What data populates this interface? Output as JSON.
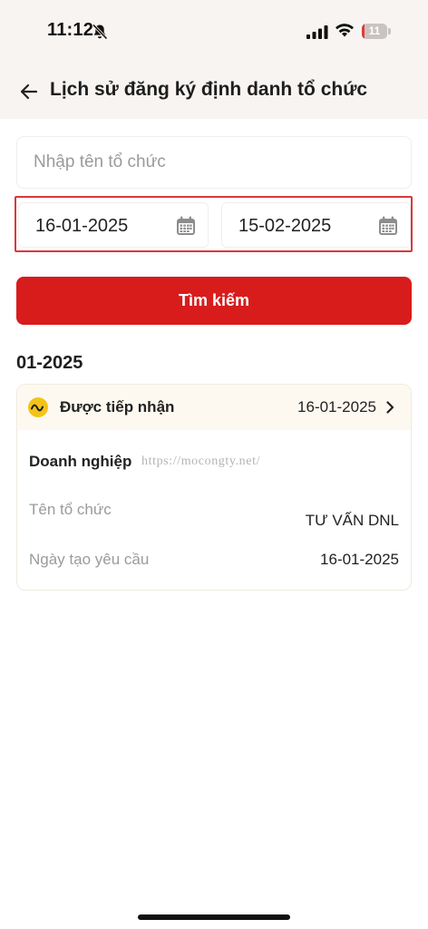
{
  "status_bar": {
    "time": "11:12",
    "battery_level": "11",
    "battery_percent": 0.11,
    "icons": [
      "bell-muted-icon",
      "cellular-signal-icon",
      "wifi-icon",
      "battery-icon"
    ]
  },
  "header": {
    "title": "Lịch sử đăng ký định danh tổ chức",
    "back_icon": "arrow-left-icon"
  },
  "search": {
    "name_placeholder": "Nhập tên tổ chức",
    "name_value": "",
    "from_date": "16-01-2025",
    "to_date": "15-02-2025",
    "calendar_icon": "calendar-icon",
    "button_label": "Tìm kiếm"
  },
  "results": {
    "section_title": "01-2025",
    "items": [
      {
        "status": "Được tiếp nhận",
        "status_icon": "wave-status-icon",
        "date": "16-01-2025",
        "org_type": "Doanh nghiệp",
        "rows": [
          {
            "label": "Tên tổ chức",
            "value": "TƯ VẤN DNL"
          },
          {
            "label": "Ngày tạo yêu cầu",
            "value": "16-01-2025"
          }
        ]
      }
    ]
  },
  "watermark": "https://mocongty.net/",
  "colors": {
    "primary_red": "#d81c1c",
    "highlight_border": "#d9383d",
    "status_yellow": "#f3c318",
    "header_bg": "#f7f4f1",
    "card_header_bg": "#fdf9f0"
  }
}
